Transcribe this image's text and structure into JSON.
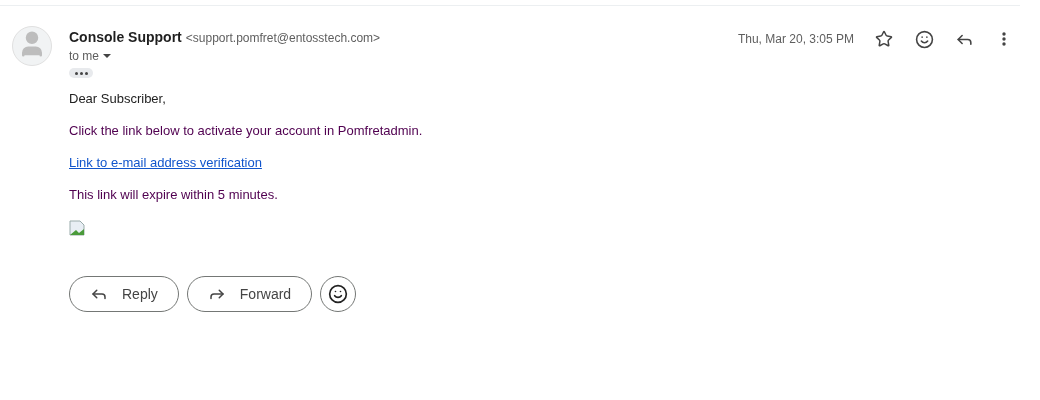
{
  "message": {
    "sender_name": "Console Support",
    "sender_email": "<support.pomfret@entosstech.com>",
    "recipient": "to me",
    "date": "Thu, Mar 20, 3:05 PM",
    "starred": false
  },
  "body": [
    {
      "kind": "text",
      "text": "Dear Subscriber,",
      "color": "#222222"
    },
    {
      "kind": "text",
      "text": "Click the link below to activate your account in Pomfretadmin.",
      "color": "#500050"
    },
    {
      "kind": "link",
      "text": "Link to e-mail address verification",
      "color": "#1155cc"
    },
    {
      "kind": "text",
      "text": "This link will expire within 5 minutes.",
      "color": "#500050"
    },
    {
      "kind": "image"
    }
  ],
  "actions": [
    {
      "kind": "reply",
      "label": "Reply"
    },
    {
      "kind": "forward",
      "label": "Forward"
    },
    {
      "kind": "emoji"
    }
  ]
}
